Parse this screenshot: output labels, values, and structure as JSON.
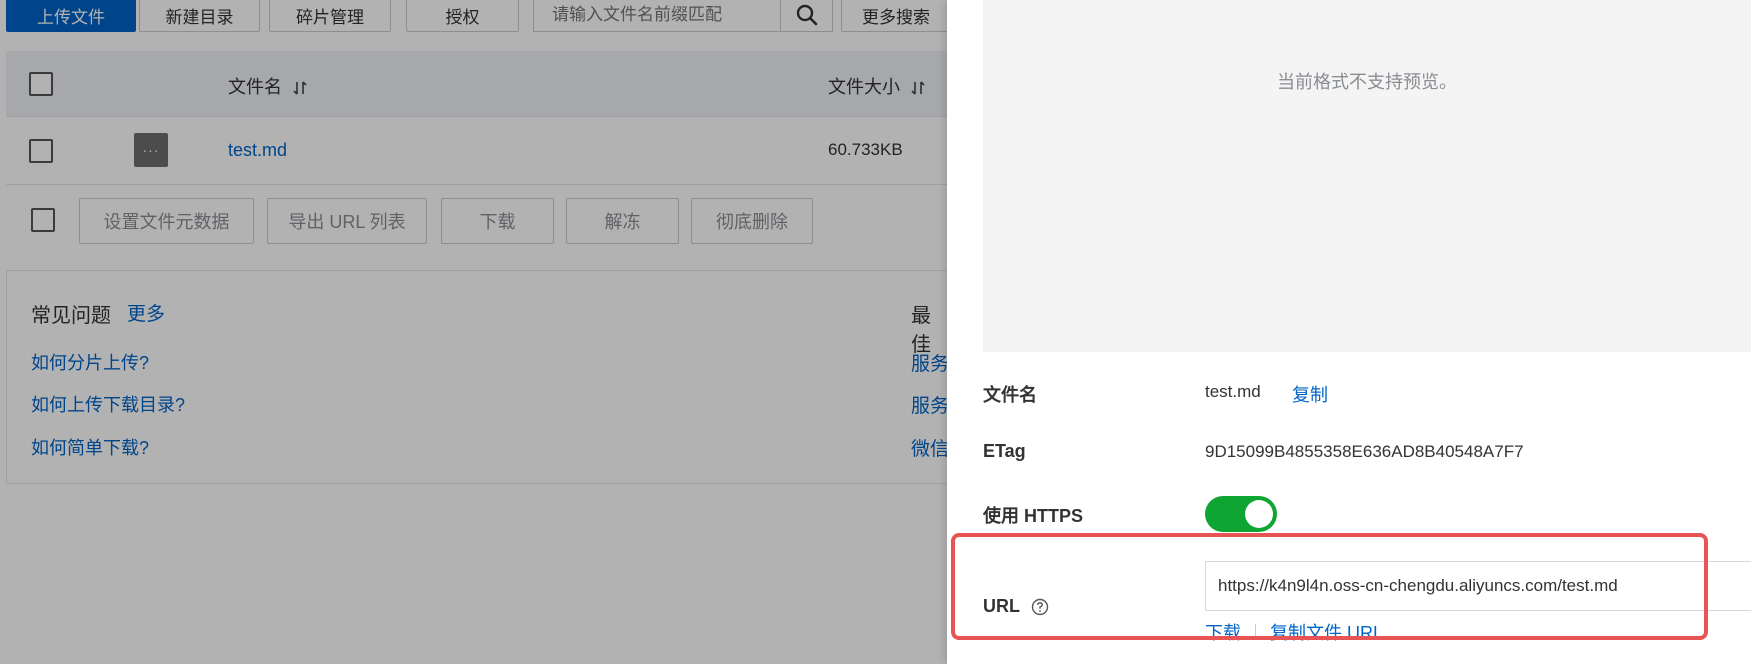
{
  "toolbar": {
    "upload": "上传文件",
    "new_dir": "新建目录",
    "fragments": "碎片管理",
    "authorize": "授权",
    "search_placeholder": "请输入文件名前缀匹配",
    "more_search": "更多搜索"
  },
  "table": {
    "col_name": "文件名",
    "col_size": "文件大小",
    "rows": [
      {
        "name": "test.md",
        "size": "60.733KB",
        "thumb": "···"
      }
    ]
  },
  "bulk_actions": {
    "set_metadata": "设置文件元数据",
    "export_urls": "导出 URL 列表",
    "download": "下载",
    "unfreeze": "解冻",
    "delete": "彻底删除"
  },
  "faq": {
    "title": "常见问题",
    "more": "更多",
    "items": [
      "如何分片上传?",
      "如何上传下载目录?",
      "如何简单下载?"
    ],
    "right_title": "最佳",
    "right_items": [
      "服务",
      "服务",
      "微信"
    ]
  },
  "drawer": {
    "preview_message": "当前格式不支持预览。",
    "filename_label": "文件名",
    "filename_value": "test.md",
    "copy_label": "复制",
    "etag_label": "ETag",
    "etag_value": "9D15099B4855358E636AD8B40548A7F7",
    "https_label": "使用 HTTPS",
    "https_enabled": true,
    "url_label": "URL",
    "url_value": "https://k4n9l4n.oss-cn-chengdu.aliyuncs.com/test.md",
    "download_label": "下载",
    "copy_url_label": "复制文件 URL"
  },
  "colors": {
    "primary": "#0064c8",
    "toggle_on": "#0fa533",
    "highlight": "#e85454"
  }
}
